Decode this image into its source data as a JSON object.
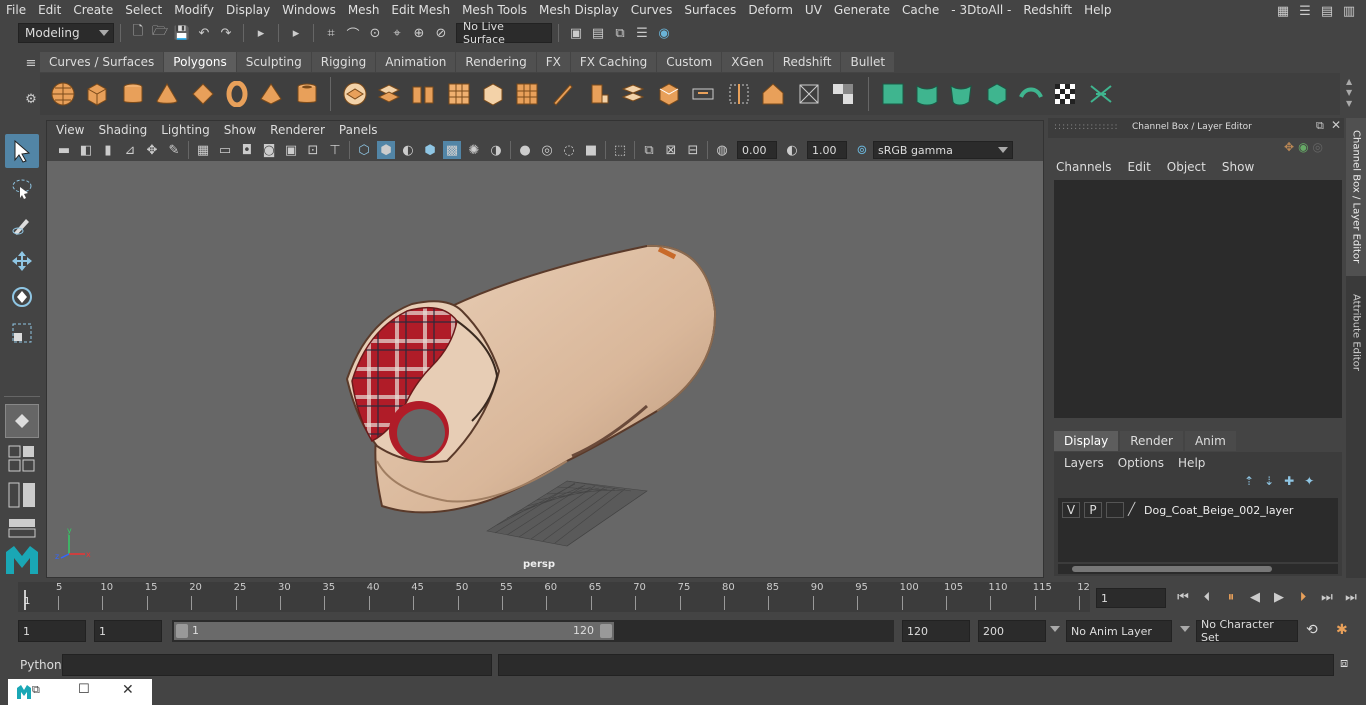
{
  "menubar": {
    "items": [
      "File",
      "Edit",
      "Create",
      "Select",
      "Modify",
      "Display",
      "Windows",
      "Mesh",
      "Edit Mesh",
      "Mesh Tools",
      "Mesh Display",
      "Curves",
      "Surfaces",
      "Deform",
      "UV",
      "Generate",
      "Cache",
      "- 3DtoAll -",
      "Redshift",
      "Help"
    ]
  },
  "statusline": {
    "mode": "Modeling",
    "live_surface": "No Live Surface"
  },
  "shelf": {
    "tabs": [
      "Curves / Surfaces",
      "Polygons",
      "Sculpting",
      "Rigging",
      "Animation",
      "Rendering",
      "FX",
      "FX Caching",
      "Custom",
      "XGen",
      "Redshift",
      "Bullet"
    ],
    "active_tab": "Polygons"
  },
  "viewport": {
    "menu": [
      "View",
      "Shading",
      "Lighting",
      "Show",
      "Renderer",
      "Panels"
    ],
    "exposure": "0.00",
    "gamma": "1.00",
    "color_space": "sRGB gamma",
    "camera_label": "persp"
  },
  "channelbox": {
    "title": "Channel Box / Layer Editor",
    "menu": [
      "Channels",
      "Edit",
      "Object",
      "Show"
    ],
    "layer_tabs": [
      "Display",
      "Render",
      "Anim"
    ],
    "layer_menu": [
      "Layers",
      "Options",
      "Help"
    ],
    "layer": {
      "v": "V",
      "p": "P",
      "name": "Dog_Coat_Beige_002_layer"
    }
  },
  "sidetabs": {
    "channel_box": "Channel Box / Layer Editor",
    "attribute_editor": "Attribute Editor"
  },
  "timeline": {
    "ticks": [
      "5",
      "10",
      "15",
      "20",
      "25",
      "30",
      "35",
      "40",
      "45",
      "50",
      "55",
      "60",
      "65",
      "70",
      "75",
      "80",
      "85",
      "90",
      "95",
      "100",
      "105",
      "110",
      "115",
      "12"
    ],
    "start_marker": "1",
    "current_frame": "1"
  },
  "range": {
    "start": "1",
    "anim_start": "1",
    "slider_start": "1",
    "slider_end": "120",
    "end": "120",
    "anim_end": "200",
    "anim_layer": "No Anim Layer",
    "character_set": "No Character Set"
  },
  "cmdline": {
    "language": "Python"
  },
  "colors": {
    "accent": "#5285a6",
    "shelf_icon": "#e8a05a",
    "shelf_icon_green": "#3fb58f",
    "coat": "#d9b79a",
    "plaid": "#b01c28"
  }
}
